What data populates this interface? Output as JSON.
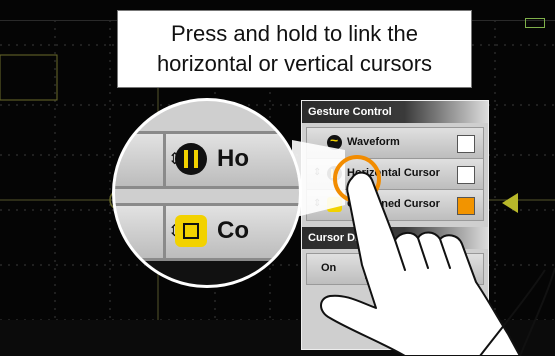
{
  "callout": {
    "line1": "Press and hold to link the",
    "line2": "horizontal or vertical cursors"
  },
  "panel": {
    "title": "Gesture Control",
    "options": [
      {
        "label": "Waveform",
        "icon": "waveform-icon",
        "checked": false
      },
      {
        "label": "Horizontal Cursor",
        "icon": "horizontal-cursor-icon",
        "checked": false
      },
      {
        "label": "Combined Cursor",
        "icon": "combined-cursor-icon",
        "checked": true
      }
    ],
    "section2_title": "Cursor Display",
    "on_label": "On"
  },
  "magnifier": {
    "row1_text": "Ho",
    "row2_text": "Co"
  },
  "colors": {
    "accent_orange": "#f28c00",
    "cursor_yellow": "#f2d200",
    "arrow_olive": "#b8b82a"
  }
}
